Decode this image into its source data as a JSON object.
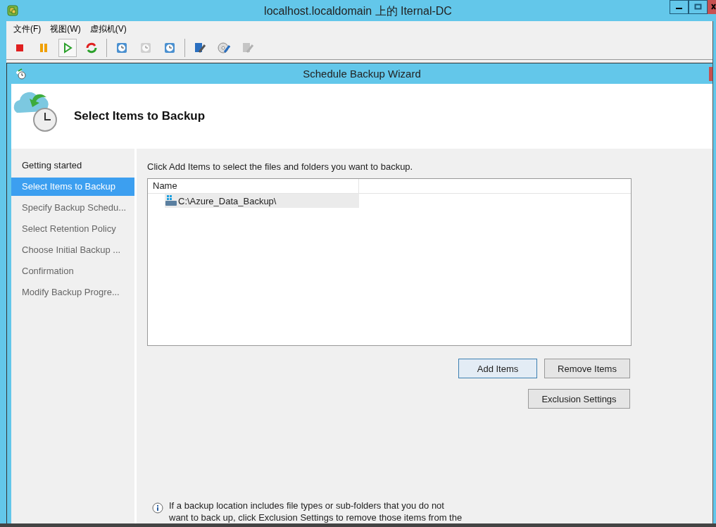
{
  "window": {
    "title": "localhost.localdomain 上的 Iternal-DC"
  },
  "menu": [
    "文件(F)",
    "视图(W)",
    "虚拟机(V)"
  ],
  "toolbar": [
    {
      "kind": "stop",
      "disabled": false,
      "pressed": false
    },
    {
      "kind": "pause",
      "disabled": false,
      "pressed": false
    },
    {
      "kind": "play",
      "disabled": false,
      "pressed": true
    },
    {
      "kind": "reset",
      "disabled": false,
      "pressed": false
    },
    {
      "kind": "separator"
    },
    {
      "kind": "clock",
      "disabled": false,
      "pressed": false
    },
    {
      "kind": "clock",
      "disabled": true,
      "pressed": false
    },
    {
      "kind": "clock",
      "disabled": false,
      "pressed": false
    },
    {
      "kind": "separator"
    },
    {
      "kind": "tool",
      "disabled": false,
      "pressed": false
    },
    {
      "kind": "disc",
      "disabled": false,
      "pressed": false
    },
    {
      "kind": "tool",
      "disabled": true,
      "pressed": false
    }
  ],
  "wizard": {
    "title": "Schedule Backup Wizard",
    "heading": "Select Items to Backup",
    "steps": [
      {
        "label": "Getting started",
        "selected": false,
        "completed": true
      },
      {
        "label": "Select Items to Backup",
        "selected": true,
        "completed": false
      },
      {
        "label": "Specify Backup Schedu...",
        "selected": false,
        "completed": false
      },
      {
        "label": "Select Retention Policy",
        "selected": false,
        "completed": false
      },
      {
        "label": "Choose Initial Backup ...",
        "selected": false,
        "completed": false
      },
      {
        "label": "Confirmation",
        "selected": false,
        "completed": false
      },
      {
        "label": "Modify Backup Progre...",
        "selected": false,
        "completed": false
      }
    ],
    "instruction": "Click Add Items to select the files and folders you want to backup.",
    "table": {
      "columns": [
        "Name"
      ],
      "rows": [
        {
          "name": "C:\\Azure_Data_Backup\\",
          "selected": true
        }
      ]
    },
    "buttons": [
      {
        "label": "Add Items",
        "default": true
      },
      {
        "label": "Remove Items",
        "default": false
      }
    ],
    "exclusion_button": {
      "label": "Exclusion Settings",
      "default": false
    },
    "info": [
      "If a backup location includes file types or sub-folders that you do not",
      "want to back up, click Exclusion Settings to remove those items from the"
    ]
  }
}
